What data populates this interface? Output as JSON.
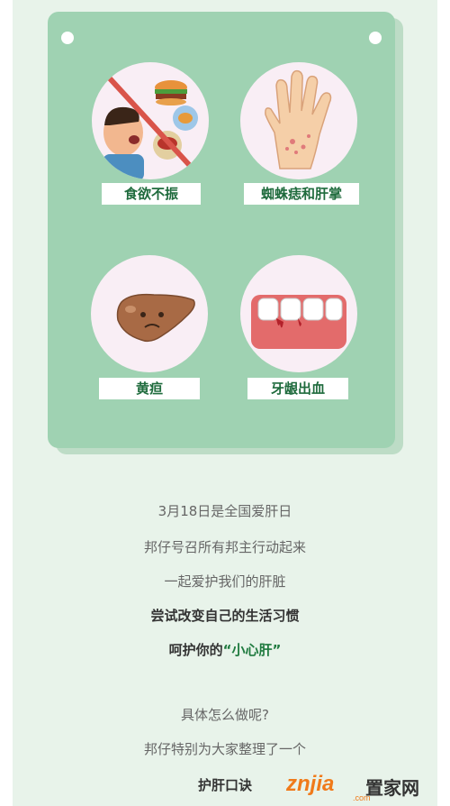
{
  "cards": [
    {
      "label": "食欲不振",
      "icon": "loss-of-appetite-illustration"
    },
    {
      "label": "蜘蛛痣和肝掌",
      "icon": "palm-illustration"
    },
    {
      "label": "黄疸",
      "icon": "liver-illustration"
    },
    {
      "label": "牙龈出血",
      "icon": "bleeding-gums-illustration"
    }
  ],
  "article": {
    "line1": "3月18日是全国爱肝日",
    "line2": "邦仔号召所有邦主行动起来",
    "line3": "一起爱护我们的肝脏",
    "line4": "尝试改变自己的生活习惯",
    "line5_prefix": "呵护你的",
    "line5_highlight": "“小心肝”",
    "line6": "具体怎么做呢?",
    "line7": "邦仔特别为大家整理了一个",
    "line8": "护肝口诀"
  },
  "watermark": {
    "brand": "znjia",
    "suffix": "置家网",
    "domain": ".com"
  },
  "colors": {
    "card": "#9fd2b2",
    "background": "#e8f3ea",
    "label_text": "#1f6b3d",
    "highlight": "#1f7a3f",
    "watermark_brand": "#f07a1a"
  }
}
